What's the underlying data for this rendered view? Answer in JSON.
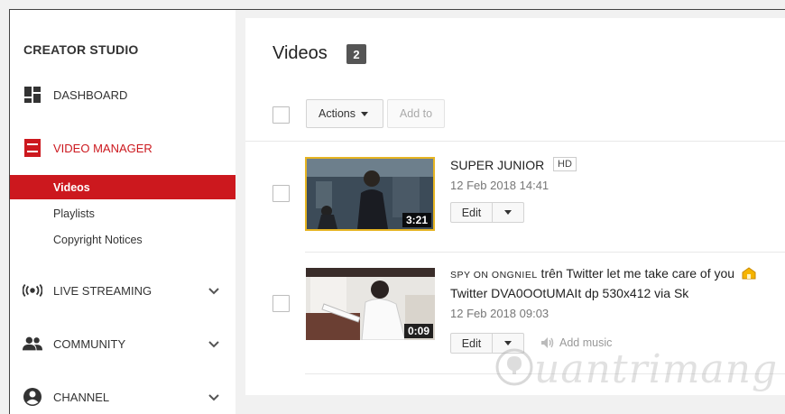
{
  "sidebar": {
    "title": "CREATOR STUDIO",
    "dashboard": {
      "label": "DASHBOARD",
      "icon": "dashboard-icon"
    },
    "video_manager": {
      "label": "VIDEO MANAGER",
      "icon": "video-manager-icon",
      "color": "#cc181e"
    },
    "sub_items": [
      {
        "label": "Videos",
        "active": true
      },
      {
        "label": "Playlists",
        "active": false
      },
      {
        "label": "Copyright Notices",
        "active": false
      }
    ],
    "live_streaming": {
      "label": "LIVE STREAMING",
      "icon": "broadcast-icon"
    },
    "community": {
      "label": "COMMUNITY",
      "icon": "people-icon"
    },
    "channel": {
      "label": "CHANNEL",
      "icon": "account-icon"
    }
  },
  "main": {
    "title": "Videos",
    "count": "2",
    "toolbar": {
      "actions_label": "Actions",
      "add_to_label": "Add to"
    },
    "videos": [
      {
        "title": "SUPER JUNIOR",
        "badge": "HD",
        "date": "12 Feb 2018 14:41",
        "duration": "3:21",
        "edit_label": "Edit"
      },
      {
        "title_prefix": "SPY ON ONGNIEL",
        "title_line1": " trên Twitter let me take care of you",
        "title_line2": "Twitter DVA0OOtUMAIt dp 530x412 via Sk",
        "date": "12 Feb 2018 09:03",
        "duration": "0:09",
        "edit_label": "Edit",
        "add_music_label": "Add music"
      }
    ]
  },
  "watermark": "uantrimang",
  "colors": {
    "accent": "#cc181e",
    "thumb_border": "#e6b422"
  }
}
